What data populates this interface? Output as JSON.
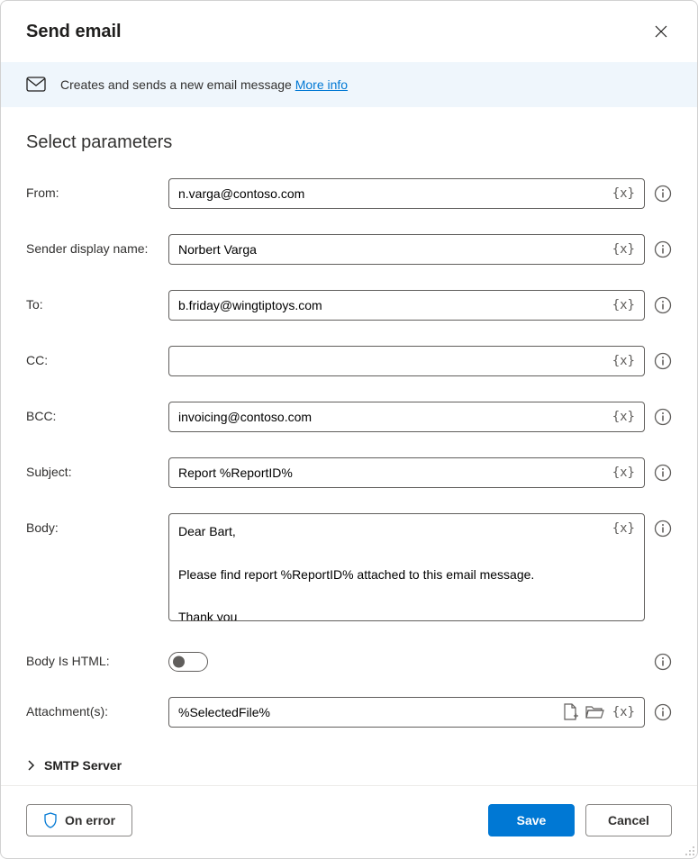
{
  "header": {
    "title": "Send email"
  },
  "banner": {
    "text": "Creates and sends a new email message ",
    "link": "More info"
  },
  "section_heading": "Select parameters",
  "fields": {
    "from": {
      "label": "From:",
      "value": "n.varga@contoso.com"
    },
    "sender_display": {
      "label": "Sender display name:",
      "value": "Norbert Varga"
    },
    "to": {
      "label": "To:",
      "value": "b.friday@wingtiptoys.com"
    },
    "cc": {
      "label": "CC:",
      "value": ""
    },
    "bcc": {
      "label": "BCC:",
      "value": "invoicing@contoso.com"
    },
    "subject": {
      "label": "Subject:",
      "value": "Report %ReportID%"
    },
    "body": {
      "label": "Body:",
      "value": "Dear Bart,\n\nPlease find report %ReportID% attached to this email message.\n\nThank you"
    },
    "body_is_html": {
      "label": "Body Is HTML:",
      "value": false
    },
    "attachments": {
      "label": "Attachment(s):",
      "value": "%SelectedFile%"
    }
  },
  "expander": {
    "smtp": "SMTP Server"
  },
  "footer": {
    "on_error": "On error",
    "save": "Save",
    "cancel": "Cancel"
  },
  "icons": {
    "variable": "{x}"
  }
}
